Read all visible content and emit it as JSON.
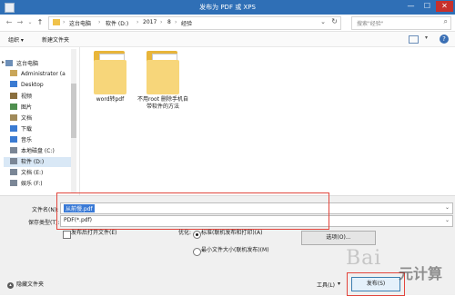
{
  "window": {
    "title": "发布为 PDF 或 XPS",
    "minimize": "—",
    "maximize": "☐",
    "close": "✕"
  },
  "nav": {
    "back": "←",
    "forward": "→",
    "recent": "⌄",
    "up": "↑",
    "breadcrumb": [
      "这台电脑",
      "软件 (D:)",
      "2017",
      "8",
      "经验"
    ],
    "separator": "›",
    "dropdown": "⌄",
    "refresh": "↻",
    "search_placeholder": "搜索\"经验\"",
    "search_icon": "⌕"
  },
  "toolbar": {
    "organize": "组织 ▾",
    "new_folder": "新建文件夹",
    "view_dropdown": "▾",
    "help": "?"
  },
  "sidebar": {
    "items": [
      {
        "label": "这台电脑",
        "icon": "computer-icon",
        "color": "#6d8fb8"
      },
      {
        "label": "Administrator (a",
        "icon": "user-folder-icon",
        "color": "#c9a659"
      },
      {
        "label": "Desktop",
        "icon": "desktop-icon",
        "color": "#3b7bd2"
      },
      {
        "label": "视频",
        "icon": "video-icon",
        "color": "#8a6f3e"
      },
      {
        "label": "图片",
        "icon": "pictures-icon",
        "color": "#4f8f4f"
      },
      {
        "label": "文档",
        "icon": "documents-icon",
        "color": "#a08a5a"
      },
      {
        "label": "下载",
        "icon": "downloads-icon",
        "color": "#3b7bd2"
      },
      {
        "label": "音乐",
        "icon": "music-icon",
        "color": "#3b7bd2"
      },
      {
        "label": "本地磁盘 (C:)",
        "icon": "drive-icon",
        "color": "#7a8696"
      },
      {
        "label": "软件 (D:)",
        "icon": "drive-icon",
        "color": "#7a8696"
      },
      {
        "label": "文档 (E:)",
        "icon": "drive-icon",
        "color": "#7a8696"
      },
      {
        "label": "娱乐 (F:)",
        "icon": "drive-icon",
        "color": "#7a8696"
      }
    ],
    "expand_arrow": "▸",
    "selected_index": 9
  },
  "files": [
    {
      "label": "word转pdf"
    },
    {
      "label": "不用root 删除手机自带软件的方法"
    }
  ],
  "form": {
    "filename_label": "文件名(N):",
    "filename_value": "从前慢.pdf",
    "savetype_label": "保存类型(T):",
    "savetype_value": "PDF(*.pdf)",
    "open_after_publish": "发布后打开文件(E)",
    "optimize_label": "优化:",
    "option_standard": "标准(联机发布和打印)(A)",
    "option_minimum": "最小文件大小(联机发布)(M)",
    "options_button": "选项(O)...",
    "tools_label": "工具(L)",
    "tools_dropdown": "▾",
    "publish_button": "发布(S)",
    "hide_folders": "隐藏文件夹",
    "hide_arrow": "▴",
    "dropdown": "⌄"
  },
  "watermark": {
    "text": "Bai",
    "text2": "元计算"
  },
  "colors": {
    "titlebar": "#2f6fb6",
    "close": "#c7302c",
    "selection": "#3a7ad6",
    "highlight_box": "#e2453c"
  }
}
